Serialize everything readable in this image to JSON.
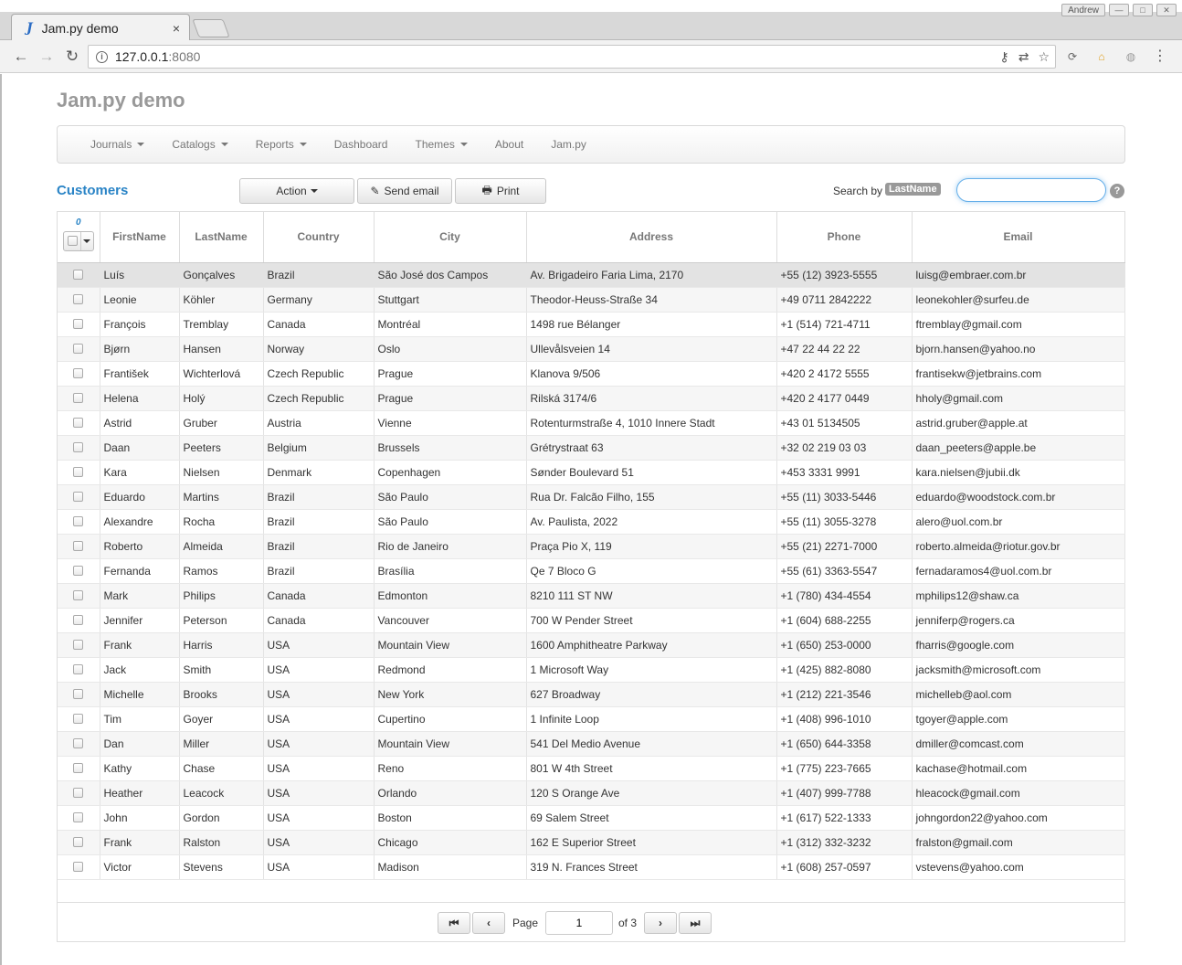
{
  "browser": {
    "tab_title": "Jam.py demo",
    "tab_favicon": "J",
    "tab_close": "×",
    "url_host": "127.0.0.1",
    "url_port": ":8080",
    "user_name": "Andrew"
  },
  "app": {
    "title": "Jam.py demo",
    "menu": [
      {
        "label": "Journals",
        "dropdown": true
      },
      {
        "label": "Catalogs",
        "dropdown": true
      },
      {
        "label": "Reports",
        "dropdown": true
      },
      {
        "label": "Dashboard",
        "dropdown": false
      },
      {
        "label": "Themes",
        "dropdown": true
      },
      {
        "label": "About",
        "dropdown": false
      },
      {
        "label": "Jam.py",
        "dropdown": false
      }
    ]
  },
  "view": {
    "title": "Customers",
    "action_label": "Action",
    "send_email_label": "Send email",
    "print_label": "Print",
    "search_prefix": "Search by",
    "search_field": "LastName",
    "search_value": "",
    "help_label": "?"
  },
  "grid": {
    "selected_count": "0",
    "columns": [
      "FirstName",
      "LastName",
      "Country",
      "City",
      "Address",
      "Phone",
      "Email"
    ],
    "rows": [
      [
        "Luís",
        "Gonçalves",
        "Brazil",
        "São José dos Campos",
        "Av. Brigadeiro Faria Lima, 2170",
        "+55 (12) 3923-5555",
        "luisg@embraer.com.br"
      ],
      [
        "Leonie",
        "Köhler",
        "Germany",
        "Stuttgart",
        "Theodor-Heuss-Straße 34",
        "+49 0711 2842222",
        "leonekohler@surfeu.de"
      ],
      [
        "François",
        "Tremblay",
        "Canada",
        "Montréal",
        "1498 rue Bélanger",
        "+1 (514) 721-4711",
        "ftremblay@gmail.com"
      ],
      [
        "Bjørn",
        "Hansen",
        "Norway",
        "Oslo",
        "Ullevålsveien 14",
        "+47 22 44 22 22",
        "bjorn.hansen@yahoo.no"
      ],
      [
        "František",
        "Wichterlová",
        "Czech Republic",
        "Prague",
        "Klanova 9/506",
        "+420 2 4172 5555",
        "frantisekw@jetbrains.com"
      ],
      [
        "Helena",
        "Holý",
        "Czech Republic",
        "Prague",
        "Rilská 3174/6",
        "+420 2 4177 0449",
        "hholy@gmail.com"
      ],
      [
        "Astrid",
        "Gruber",
        "Austria",
        "Vienne",
        "Rotenturmstraße 4, 1010 Innere Stadt",
        "+43 01 5134505",
        "astrid.gruber@apple.at"
      ],
      [
        "Daan",
        "Peeters",
        "Belgium",
        "Brussels",
        "Grétrystraat 63",
        "+32 02 219 03 03",
        "daan_peeters@apple.be"
      ],
      [
        "Kara",
        "Nielsen",
        "Denmark",
        "Copenhagen",
        "Sønder Boulevard 51",
        "+453 3331 9991",
        "kara.nielsen@jubii.dk"
      ],
      [
        "Eduardo",
        "Martins",
        "Brazil",
        "São Paulo",
        "Rua Dr. Falcão Filho, 155",
        "+55 (11) 3033-5446",
        "eduardo@woodstock.com.br"
      ],
      [
        "Alexandre",
        "Rocha",
        "Brazil",
        "São Paulo",
        "Av. Paulista, 2022",
        "+55 (11) 3055-3278",
        "alero@uol.com.br"
      ],
      [
        "Roberto",
        "Almeida",
        "Brazil",
        "Rio de Janeiro",
        "Praça Pio X, 119",
        "+55 (21) 2271-7000",
        "roberto.almeida@riotur.gov.br"
      ],
      [
        "Fernanda",
        "Ramos",
        "Brazil",
        "Brasília",
        "Qe 7 Bloco G",
        "+55 (61) 3363-5547",
        "fernadaramos4@uol.com.br"
      ],
      [
        "Mark",
        "Philips",
        "Canada",
        "Edmonton",
        "8210 111 ST NW",
        "+1 (780) 434-4554",
        "mphilips12@shaw.ca"
      ],
      [
        "Jennifer",
        "Peterson",
        "Canada",
        "Vancouver",
        "700 W Pender Street",
        "+1 (604) 688-2255",
        "jenniferp@rogers.ca"
      ],
      [
        "Frank",
        "Harris",
        "USA",
        "Mountain View",
        "1600 Amphitheatre Parkway",
        "+1 (650) 253-0000",
        "fharris@google.com"
      ],
      [
        "Jack",
        "Smith",
        "USA",
        "Redmond",
        "1 Microsoft Way",
        "+1 (425) 882-8080",
        "jacksmith@microsoft.com"
      ],
      [
        "Michelle",
        "Brooks",
        "USA",
        "New York",
        "627 Broadway",
        "+1 (212) 221-3546",
        "michelleb@aol.com"
      ],
      [
        "Tim",
        "Goyer",
        "USA",
        "Cupertino",
        "1 Infinite Loop",
        "+1 (408) 996-1010",
        "tgoyer@apple.com"
      ],
      [
        "Dan",
        "Miller",
        "USA",
        "Mountain View",
        "541 Del Medio Avenue",
        "+1 (650) 644-3358",
        "dmiller@comcast.com"
      ],
      [
        "Kathy",
        "Chase",
        "USA",
        "Reno",
        "801 W 4th Street",
        "+1 (775) 223-7665",
        "kachase@hotmail.com"
      ],
      [
        "Heather",
        "Leacock",
        "USA",
        "Orlando",
        "120 S Orange Ave",
        "+1 (407) 999-7788",
        "hleacock@gmail.com"
      ],
      [
        "John",
        "Gordon",
        "USA",
        "Boston",
        "69 Salem Street",
        "+1 (617) 522-1333",
        "johngordon22@yahoo.com"
      ],
      [
        "Frank",
        "Ralston",
        "USA",
        "Chicago",
        "162 E Superior Street",
        "+1 (312) 332-3232",
        "fralston@gmail.com"
      ],
      [
        "Victor",
        "Stevens",
        "USA",
        "Madison",
        "319 N. Frances Street",
        "+1 (608) 257-0597",
        "vstevens@yahoo.com"
      ]
    ]
  },
  "pager": {
    "page_label": "Page",
    "current_page": "1",
    "of_label": "of 3"
  },
  "colors": {
    "accent": "#2a84c6",
    "selected_row": "#e3e3e3"
  }
}
